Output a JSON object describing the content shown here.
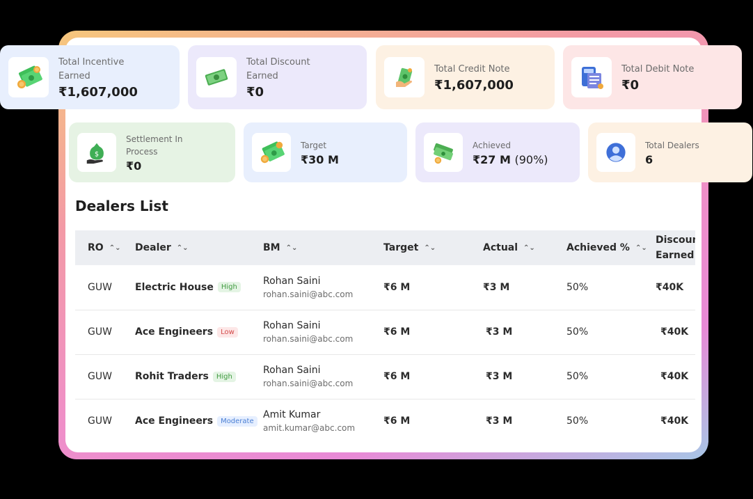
{
  "summary_top": [
    {
      "label": "Total Incentive Earned",
      "value": "₹1,607,000",
      "icon": "money-cash-icon",
      "bg": "#e8effd"
    },
    {
      "label": "Total Discount Earned",
      "value": "₹0",
      "icon": "banknote-icon",
      "bg": "#ece9fb"
    },
    {
      "label": "Total Credit Note",
      "value": "₹1,607,000",
      "icon": "banknote-hand-icon",
      "bg": "#fdf1e3"
    },
    {
      "label": "Total Debit Note",
      "value": "₹0",
      "icon": "calculator-invoice-icon",
      "bg": "#fde6e6"
    }
  ],
  "summary_bottom": [
    {
      "label": "Settlement In Process",
      "value": "₹0",
      "icon": "money-bag-hand-icon",
      "bg": "#e6f3e4"
    },
    {
      "label": "Target",
      "value": "₹30 M",
      "icon": "money-cash-icon",
      "bg": "#e8effd"
    },
    {
      "label": "Achieved",
      "value": "₹27 M",
      "value_pct": "(90%)",
      "icon": "money-stack-icon",
      "bg": "#ece9fb"
    },
    {
      "label": "Total Dealers",
      "value": "6",
      "icon": "user-avatar-icon",
      "bg": "#fdf1e3"
    }
  ],
  "section_title": "Dealers List",
  "table": {
    "headers": {
      "ro": "RO",
      "dealer": "Dealer",
      "bm": "BM",
      "target": "Target",
      "actual": "Actual",
      "achieved": "Achieved %",
      "discount": "Discount Earned"
    },
    "rows": [
      {
        "ro": "GUW",
        "dealer": "Electric House",
        "tag": "High",
        "bm_name": "Rohan Saini",
        "bm_email": "rohan.saini@abc.com",
        "target": "₹6 M",
        "actual": "₹3 M",
        "achieved": "50%",
        "discount": "₹40K"
      },
      {
        "ro": "GUW",
        "dealer": "Ace Engineers",
        "tag": "Low",
        "bm_name": "Rohan Saini",
        "bm_email": "rohan.saini@abc.com",
        "target": "₹6 M",
        "actual": "₹3 M",
        "achieved": "50%",
        "discount": "₹40K"
      },
      {
        "ro": "GUW",
        "dealer": "Rohit Traders",
        "tag": "High",
        "bm_name": "Rohan Saini",
        "bm_email": "rohan.saini@abc.com",
        "target": "₹6 M",
        "actual": "₹3 M",
        "achieved": "50%",
        "discount": "₹40K"
      },
      {
        "ro": "GUW",
        "dealer": "Ace Engineers",
        "tag": "Moderate",
        "bm_name": "Amit Kumar",
        "bm_email": "amit.kumar@abc.com",
        "target": "₹6 M",
        "actual": "₹3 M",
        "achieved": "50%",
        "discount": "₹40K"
      }
    ]
  }
}
